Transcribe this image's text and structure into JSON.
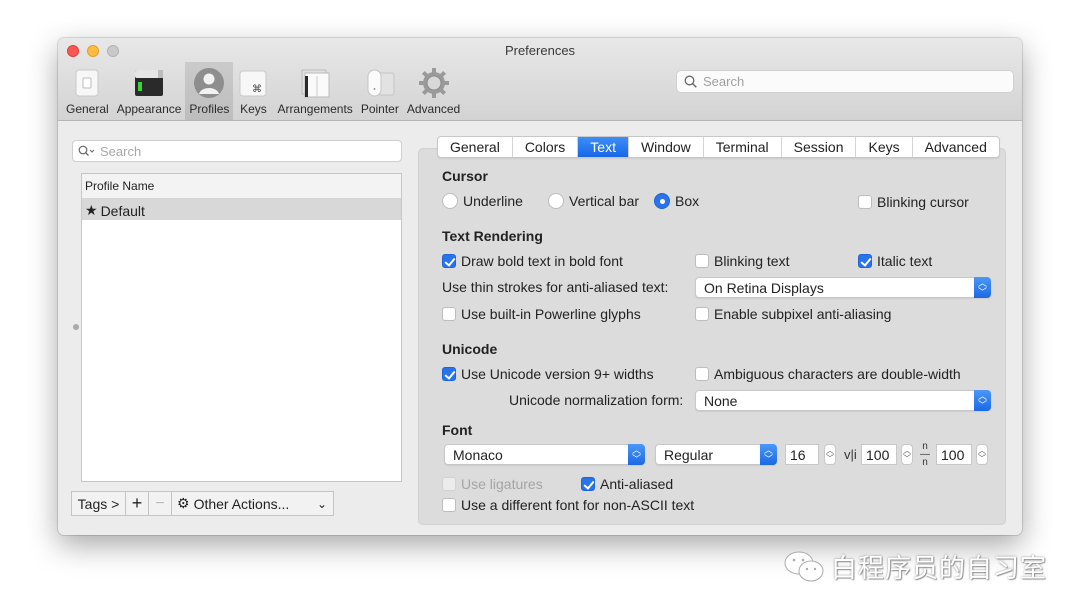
{
  "window": {
    "title": "Preferences"
  },
  "toolbar": {
    "items": [
      {
        "label": "General",
        "icon": "general-icon",
        "active": false
      },
      {
        "label": "Appearance",
        "icon": "appearance-icon",
        "active": false
      },
      {
        "label": "Profiles",
        "icon": "profiles-icon",
        "active": true
      },
      {
        "label": "Keys",
        "icon": "keys-icon",
        "active": false
      },
      {
        "label": "Arrangements",
        "icon": "arrangements-icon",
        "active": false
      },
      {
        "label": "Pointer",
        "icon": "pointer-icon",
        "active": false
      },
      {
        "label": "Advanced",
        "icon": "advanced-gear-icon",
        "active": false
      }
    ],
    "search_placeholder": "Search",
    "search_value": ""
  },
  "profiles": {
    "search_placeholder": "Search",
    "search_value": "",
    "column_header": "Profile Name",
    "rows": [
      {
        "name": "Default",
        "default_marker": "★",
        "selected": true
      }
    ],
    "buttons": {
      "tags": "Tags >",
      "add": "+",
      "remove": "−",
      "other_actions": "Other Actions...",
      "other_actions_arrow": "⌄"
    }
  },
  "tabs": [
    {
      "label": "General",
      "active": false
    },
    {
      "label": "Colors",
      "active": false
    },
    {
      "label": "Text",
      "active": true
    },
    {
      "label": "Window",
      "active": false
    },
    {
      "label": "Terminal",
      "active": false
    },
    {
      "label": "Session",
      "active": false
    },
    {
      "label": "Keys",
      "active": false
    },
    {
      "label": "Advanced",
      "active": false
    }
  ],
  "cursor": {
    "title": "Cursor",
    "options": [
      {
        "label": "Underline",
        "selected": false
      },
      {
        "label": "Vertical bar",
        "selected": false
      },
      {
        "label": "Box",
        "selected": true
      }
    ],
    "blinking": {
      "label": "Blinking cursor",
      "checked": false
    }
  },
  "text_rendering": {
    "title": "Text Rendering",
    "bold": {
      "label": "Draw bold text in bold font",
      "checked": true
    },
    "blinking_text": {
      "label": "Blinking text",
      "checked": false
    },
    "italic": {
      "label": "Italic text",
      "checked": true
    },
    "thin_strokes_label": "Use thin strokes for anti-aliased text:",
    "thin_strokes_value": "On Retina Displays",
    "powerline": {
      "label": "Use built-in Powerline glyphs",
      "checked": false
    },
    "subpixel": {
      "label": "Enable subpixel anti-aliasing",
      "checked": false
    }
  },
  "unicode": {
    "title": "Unicode",
    "v9_widths": {
      "label": "Use Unicode version 9+ widths",
      "checked": true
    },
    "ambiguous": {
      "label": "Ambiguous characters are double-width",
      "checked": false
    },
    "normalization_label": "Unicode normalization form:",
    "normalization_value": "None"
  },
  "font": {
    "title": "Font",
    "family": "Monaco",
    "style": "Regular",
    "size": "16",
    "horizontal_spacing_glyph": "v|i",
    "horizontal_spacing": "100",
    "vertical_spacing_glyph": "n/n",
    "vertical_spacing": "100",
    "ligatures": {
      "label": "Use ligatures",
      "checked": false,
      "disabled": true
    },
    "anti_aliased": {
      "label": "Anti-aliased",
      "checked": true
    },
    "non_ascii": {
      "label": "Use a different font for non-ASCII text",
      "checked": false
    }
  },
  "watermark": {
    "text": "白程序员的自习室",
    "icon": "wechat-icon"
  }
}
